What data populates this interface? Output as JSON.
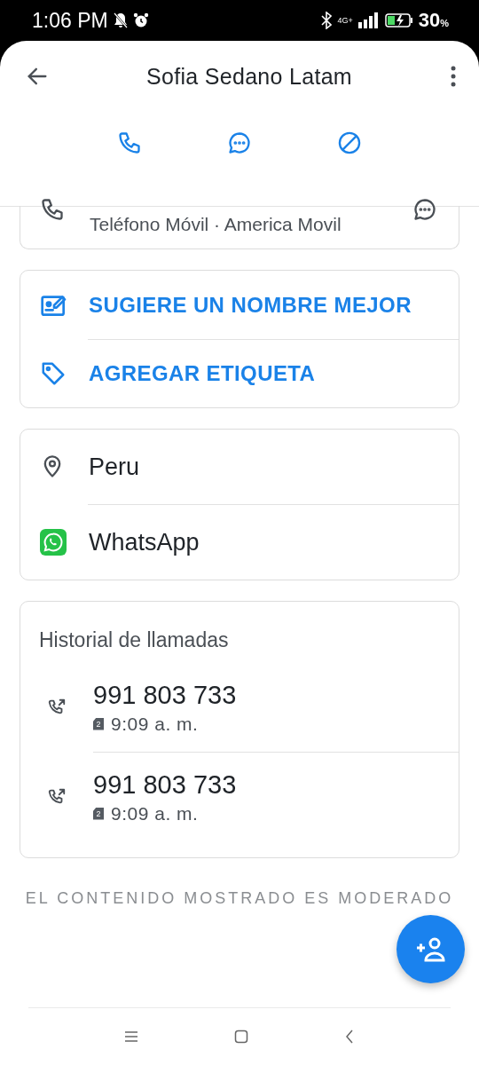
{
  "status_bar": {
    "time": "1:06 PM",
    "network": "4G+",
    "battery": "30",
    "battery_unit": "%"
  },
  "header": {
    "title": "Sofia Sedano Latam"
  },
  "actions": [
    {
      "kind": "call"
    },
    {
      "kind": "message"
    },
    {
      "kind": "block"
    }
  ],
  "phone_card": {
    "subtitle": "Teléfono Móvil · America Movil"
  },
  "suggest_card": [
    {
      "kind": "edit",
      "label": "SUGIERE UN NOMBRE MEJOR"
    },
    {
      "kind": "tag",
      "label": "AGREGAR ETIQUETA"
    }
  ],
  "info_card": [
    {
      "kind": "location",
      "label": "Peru"
    },
    {
      "kind": "whatsapp",
      "label": "WhatsApp"
    }
  ],
  "call_history": {
    "title": "Historial de llamadas",
    "calls": [
      {
        "number": "991 803 733",
        "sim": "2",
        "time": "9:09 a. m."
      },
      {
        "number": "991 803 733",
        "sim": "2",
        "time": "9:09 a. m."
      }
    ]
  },
  "footer_note": "EL CONTENIDO MOSTRADO ES MODERADO"
}
